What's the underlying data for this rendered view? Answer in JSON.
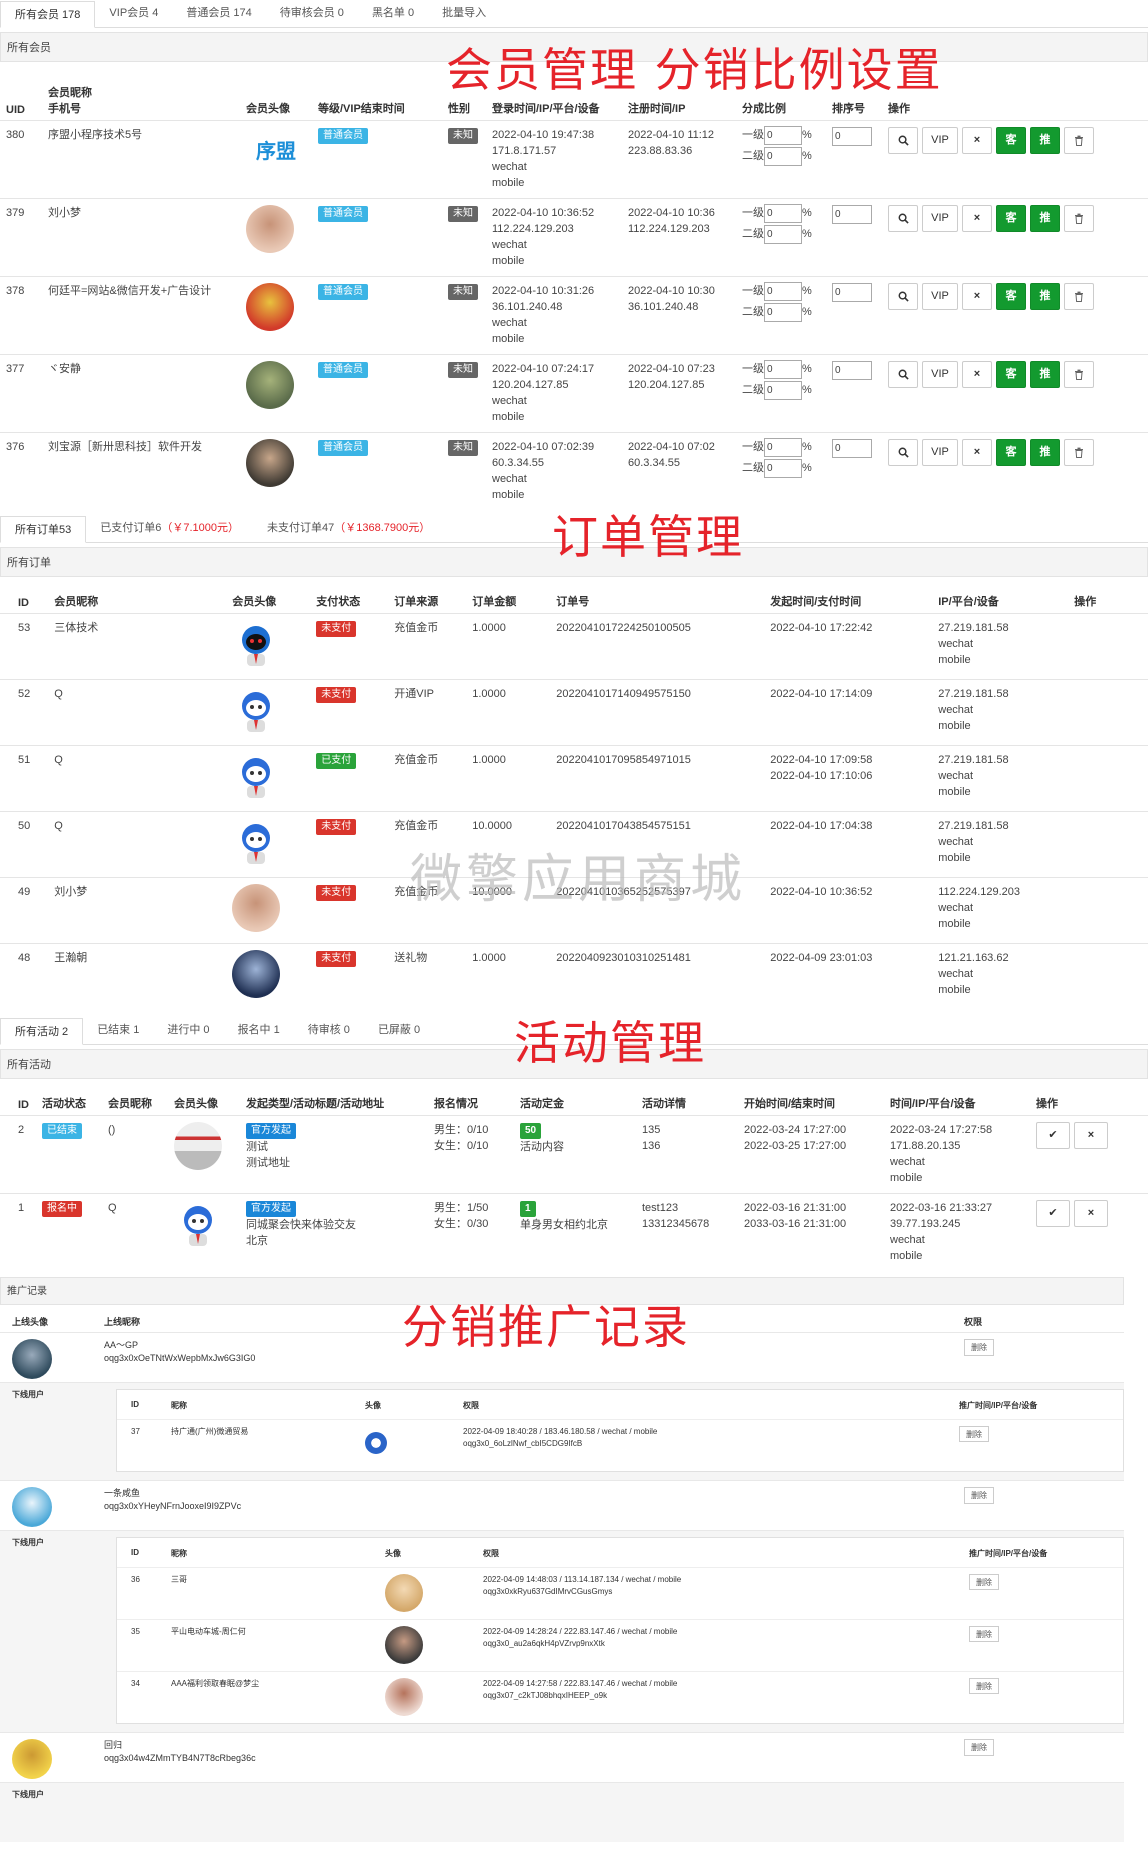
{
  "member_tabs": [
    "所有会员 178",
    "VIP会员 4",
    "普通会员 174",
    "待审核会员 0",
    "黑名单 0",
    "批量导入"
  ],
  "member_panel": "所有会员",
  "annotations": {
    "members": "会员管理  分销比例设置",
    "orders": "订单管理",
    "activities": "活动管理",
    "promotion": "分销推广记录"
  },
  "watermark": "微擎应用商城",
  "member_headers": {
    "uid": "UID",
    "nick": "会员昵称",
    "phone": "手机号",
    "avatar": "会员头像",
    "level": "等级/VIP结束时间",
    "gender": "性别",
    "login": "登录时间/IP/平台/设备",
    "reg": "注册时间/IP",
    "ratio": "分成比例",
    "sort": "排序号",
    "op": "操作"
  },
  "members": [
    {
      "uid": "380",
      "nick": "序盟小程序技术5号",
      "avatar_text": "序盟",
      "level": "普通会员",
      "gender": "未知",
      "login_time": "2022-04-10 19:47:38",
      "login_ip": "171.8.171.57",
      "platform": "wechat",
      "device": "mobile",
      "reg_time": "2022-04-10 11:12",
      "reg_ip": "223.88.83.36",
      "r1": "0",
      "r2": "0",
      "sort": "0"
    },
    {
      "uid": "379",
      "nick": "刘小梦",
      "avatar_text": "",
      "level": "普通会员",
      "gender": "未知",
      "login_time": "2022-04-10 10:36:52",
      "login_ip": "112.224.129.203",
      "platform": "wechat",
      "device": "mobile",
      "reg_time": "2022-04-10 10:36",
      "reg_ip": "112.224.129.203",
      "r1": "0",
      "r2": "0",
      "sort": "0"
    },
    {
      "uid": "378",
      "nick": "何廷平=网站&微信开发+广告设计",
      "avatar_text": "",
      "level": "普通会员",
      "gender": "未知",
      "login_time": "2022-04-10 10:31:26",
      "login_ip": "36.101.240.48",
      "platform": "wechat",
      "device": "mobile",
      "reg_time": "2022-04-10 10:30",
      "reg_ip": "36.101.240.48",
      "r1": "0",
      "r2": "0",
      "sort": "0"
    },
    {
      "uid": "377",
      "nick": "ヾ安静",
      "avatar_text": "",
      "level": "普通会员",
      "gender": "未知",
      "login_time": "2022-04-10 07:24:17",
      "login_ip": "120.204.127.85",
      "platform": "wechat",
      "device": "mobile",
      "reg_time": "2022-04-10 07:23",
      "reg_ip": "120.204.127.85",
      "r1": "0",
      "r2": "0",
      "sort": "0"
    },
    {
      "uid": "376",
      "nick": "刘宝源［新卅思科技］软件开发",
      "avatar_text": "",
      "level": "普通会员",
      "gender": "未知",
      "login_time": "2022-04-10 07:02:39",
      "login_ip": "60.3.34.55",
      "platform": "wechat",
      "device": "mobile",
      "reg_time": "2022-04-10 07:02",
      "reg_ip": "60.3.34.55",
      "r1": "0",
      "r2": "0",
      "sort": "0"
    }
  ],
  "ratio_labels": {
    "l1": "一级",
    "l2": "二级",
    "pct": "%"
  },
  "member_buttons": {
    "vip": "VIP",
    "close": "×",
    "ke": "客",
    "tui": "推"
  },
  "order_tabs": [
    {
      "label": "所有订单53",
      "extra": ""
    },
    {
      "label": "已支付订单6",
      "extra": "（￥7.1000元）"
    },
    {
      "label": "未支付订单47",
      "extra": "（￥1368.7900元）"
    }
  ],
  "order_panel": "所有订单",
  "order_headers": {
    "id": "ID",
    "nick": "会员昵称",
    "avatar": "会员头像",
    "status": "支付状态",
    "source": "订单来源",
    "amount": "订单金额",
    "no": "订单号",
    "time": "发起时间/支付时间",
    "ip": "IP/平台/设备",
    "op": "操作"
  },
  "orders": [
    {
      "id": "53",
      "nick": "三体技术",
      "status": "未支付",
      "source": "充值金币",
      "amount": "1.0000",
      "no": "2022041017224250100505",
      "t1": "2022-04-10 17:22:42",
      "t2": "",
      "ip": "27.219.181.58",
      "platform": "wechat",
      "device": "mobile"
    },
    {
      "id": "52",
      "nick": "Q",
      "status": "未支付",
      "source": "开通VIP",
      "amount": "1.0000",
      "no": "2022041017140949575150",
      "t1": "2022-04-10 17:14:09",
      "t2": "",
      "ip": "27.219.181.58",
      "platform": "wechat",
      "device": "mobile"
    },
    {
      "id": "51",
      "nick": "Q",
      "status": "已支付",
      "source": "充值金币",
      "amount": "1.0000",
      "no": "2022041017095854971015",
      "t1": "2022-04-10 17:09:58",
      "t2": "2022-04-10 17:10:06",
      "ip": "27.219.181.58",
      "platform": "wechat",
      "device": "mobile"
    },
    {
      "id": "50",
      "nick": "Q",
      "status": "未支付",
      "source": "充值金币",
      "amount": "10.0000",
      "no": "2022041017043854575151",
      "t1": "2022-04-10 17:04:38",
      "t2": "",
      "ip": "27.219.181.58",
      "platform": "wechat",
      "device": "mobile"
    },
    {
      "id": "49",
      "nick": "刘小梦",
      "status": "未支付",
      "source": "充值金币",
      "amount": "10.0000",
      "no": "2022041010365252575397",
      "t1": "2022-04-10 10:36:52",
      "t2": "",
      "ip": "112.224.129.203",
      "platform": "wechat",
      "device": "mobile"
    },
    {
      "id": "48",
      "nick": "王瀚朝",
      "status": "未支付",
      "source": "送礼物",
      "amount": "1.0000",
      "no": "2022040923010310251481",
      "t1": "2022-04-09 23:01:03",
      "t2": "",
      "ip": "121.21.163.62",
      "platform": "wechat",
      "device": "mobile"
    }
  ],
  "activity_tabs": [
    "所有活动 2",
    "已结束 1",
    "进行中 0",
    "报名中 1",
    "待审核 0",
    "已屏蔽 0"
  ],
  "activity_panel": "所有活动",
  "activity_headers": {
    "id": "ID",
    "state": "活动状态",
    "nick": "会员昵称",
    "avatar": "会员头像",
    "type": "发起类型/活动标题/活动地址",
    "signup": "报名情况",
    "deposit": "活动定金",
    "detail": "活动详情",
    "time": "开始时间/结束时间",
    "meta": "时间/IP/平台/设备",
    "op": "操作"
  },
  "activities": [
    {
      "id": "2",
      "state": "已结束",
      "nick": "()",
      "type": "官方发起",
      "title": "测试",
      "addr": "测试地址",
      "male": "男生：0/10",
      "female": "女生：0/10",
      "deposit": "50",
      "deposit_text": "活动内容",
      "d1": "135",
      "d2": "136",
      "start": "2022-03-24 17:27:00",
      "end": "2022-03-25 17:27:00",
      "mtime": "2022-03-24 17:27:58",
      "mip": "171.88.20.135",
      "platform": "wechat",
      "device": "mobile"
    },
    {
      "id": "1",
      "state": "报名中",
      "nick": "Q",
      "type": "官方发起",
      "title": "同城聚会快来体验交友",
      "addr": "北京",
      "male": "男生：1/50",
      "female": "女生：0/30",
      "deposit": "1",
      "deposit_text": "单身男女相约北京",
      "d1": "test123",
      "d2": "13312345678",
      "start": "2022-03-16 21:31:00",
      "end": "2033-03-16 21:31:00",
      "mtime": "2022-03-16 21:33:27",
      "mip": "39.77.193.245",
      "platform": "wechat",
      "device": "mobile"
    }
  ],
  "activity_buttons": {
    "ok": "✔",
    "close": "×"
  },
  "promo_panel": "推广记录",
  "promo_headers": {
    "avatar": "上线头像",
    "nick": "上线昵称",
    "perm": "权限",
    "down": "下线用户",
    "id": "ID",
    "nick2": "昵称",
    "avatar2": "头像",
    "perm2": "权限",
    "time": "推广时间/IP/平台/设备",
    "del": "删除"
  },
  "promo": [
    {
      "nick": "AA～GP",
      "openid": "oqg3x0xOeTNtWxWepbMxJw6G3IG0",
      "children": [
        {
          "id": "37",
          "nick": "持广通(广州)微通贸易",
          "meta": "2022-04-09 18:40:28 / 183.46.180.58 / wechat / mobile",
          "openid": "oqg3x0_6oLzlNwf_cbI5CDG9IfcB"
        }
      ]
    },
    {
      "nick": "一条咸鱼",
      "openid": "oqg3x0xYHeyNFrnJooxeI9I9ZPVc",
      "children": [
        {
          "id": "36",
          "nick": "三哥",
          "meta": "2022-04-09 14:48:03 / 113.14.187.134 / wechat / mobile",
          "openid": "oqg3x0xkRyu637GdIMrvCGusGmys"
        },
        {
          "id": "35",
          "nick": "平山电动车城-周仁何",
          "meta": "2022-04-09 14:28:24 / 222.83.147.46 / wechat / mobile",
          "openid": "oqg3x0_au2a6qkH4pVZrvp9nxXtk"
        },
        {
          "id": "34",
          "nick": "AAA福利领取春眠@梦尘",
          "meta": "2022-04-09 14:27:58 / 222.83.147.46 / wechat / mobile",
          "openid": "oqg3x07_c2kTJ08bhqxIHEEP_o9k"
        }
      ]
    },
    {
      "nick": "回归",
      "openid": "oqg3x04w4ZMmTYB4N7T8cRbeg36c",
      "children": []
    }
  ]
}
